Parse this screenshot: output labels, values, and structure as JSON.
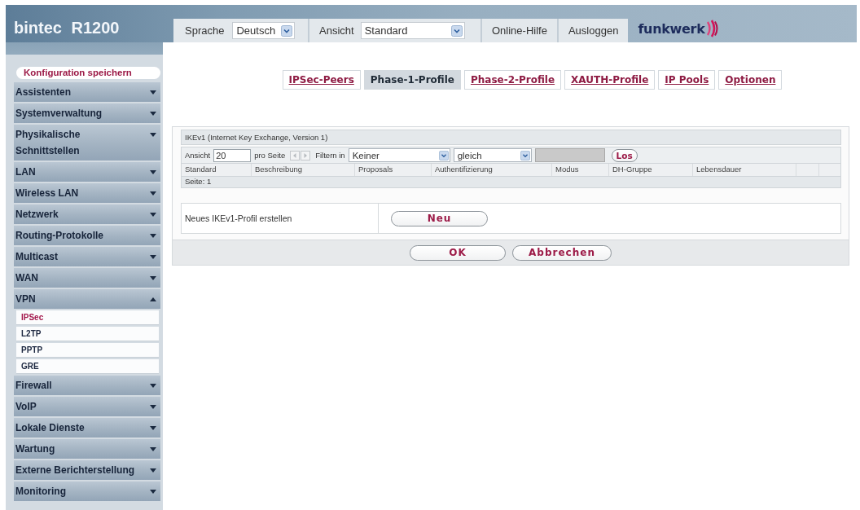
{
  "header": {
    "product": "bintec R1200",
    "language": {
      "label": "Sprache",
      "value": "Deutsch"
    },
    "view": {
      "label": "Ansicht",
      "value": "Standard"
    },
    "buttons": [
      "Online-Hilfe",
      "Ausloggen"
    ],
    "brand": "funkwerk"
  },
  "sidebar": {
    "save_button": "Konfiguration speichern",
    "items": [
      {
        "label": "Assistenten",
        "expanded": false
      },
      {
        "label": "Systemverwaltung",
        "expanded": false
      },
      {
        "label": "Physikalische Schnittstellen",
        "expanded": false
      },
      {
        "label": "LAN",
        "expanded": false
      },
      {
        "label": "Wireless LAN",
        "expanded": false
      },
      {
        "label": "Netzwerk",
        "expanded": false
      },
      {
        "label": "Routing-Protokolle",
        "expanded": false
      },
      {
        "label": "Multicast",
        "expanded": false
      },
      {
        "label": "WAN",
        "expanded": false
      },
      {
        "label": "VPN",
        "expanded": true,
        "children": [
          {
            "label": "IPSec",
            "selected": true
          },
          {
            "label": "L2TP",
            "selected": false
          },
          {
            "label": "PPTP",
            "selected": false
          },
          {
            "label": "GRE",
            "selected": false
          }
        ]
      },
      {
        "label": "Firewall",
        "expanded": false
      },
      {
        "label": "VoIP",
        "expanded": false
      },
      {
        "label": "Lokale Dienste",
        "expanded": false
      },
      {
        "label": "Wartung",
        "expanded": false
      },
      {
        "label": "Externe Berichterstellung",
        "expanded": false
      },
      {
        "label": "Monitoring",
        "expanded": false
      }
    ]
  },
  "tabs": [
    {
      "label": "IPSec-Peers",
      "selected": false
    },
    {
      "label": "Phase-1-Profile",
      "selected": true
    },
    {
      "label": "Phase-2-Profile",
      "selected": false
    },
    {
      "label": "XAUTH-Profile",
      "selected": false
    },
    {
      "label": "IP Pools",
      "selected": false
    },
    {
      "label": "Optionen",
      "selected": false
    }
  ],
  "profile_list": {
    "title": "IKEv1 (Internet Key Exchange, Version 1)",
    "filter": {
      "view_label": "Ansicht",
      "per_page": "20",
      "per_page_label": "pro Seite",
      "filter_label": "Filtern in",
      "field": "Keiner",
      "operator": "gleich",
      "go_button": "Los"
    },
    "columns": [
      "Standard",
      "Beschreibung",
      "Proposals",
      "Authentifizierung",
      "Modus",
      "DH-Gruppe",
      "Lebensdauer"
    ],
    "page_info": "Seite: 1",
    "create": {
      "label": "Neues IKEv1-Profil erstellen",
      "button": "Neu"
    }
  },
  "actions": [
    "OK",
    "Abbrechen"
  ]
}
